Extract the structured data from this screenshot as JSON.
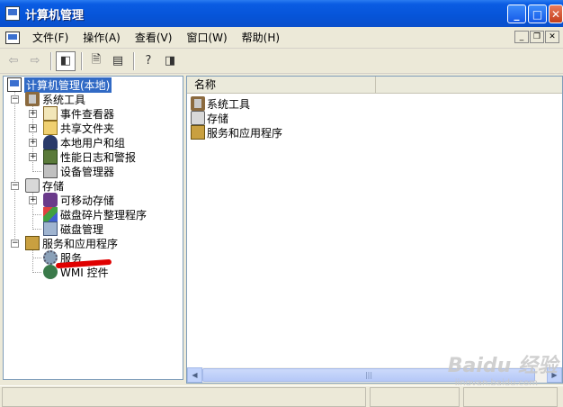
{
  "window": {
    "title": "计算机管理"
  },
  "menu": {
    "items": [
      "文件(F)",
      "操作(A)",
      "查看(V)",
      "窗口(W)",
      "帮助(H)"
    ]
  },
  "toolbar": {
    "buttons": [
      "back-icon",
      "forward-icon",
      "show-hide-tree-icon",
      "properties-icon",
      "export-list-icon",
      "help-icon",
      "show-hide-action-pane-icon"
    ]
  },
  "tree": {
    "root": "计算机管理(本地)",
    "system_tools": "系统工具",
    "event_viewer": "事件查看器",
    "shared_folders": "共享文件夹",
    "local_users": "本地用户和组",
    "perf_logs": "性能日志和警报",
    "device_manager": "设备管理器",
    "storage": "存储",
    "removable_storage": "可移动存储",
    "defrag": "磁盘碎片整理程序",
    "disk_management": "磁盘管理",
    "services_apps": "服务和应用程序",
    "services": "服务",
    "wmi": "WMI 控件"
  },
  "list": {
    "column_name": "名称",
    "items": [
      "系统工具",
      "存储",
      "服务和应用程序"
    ]
  },
  "watermark": {
    "text": "Baidu 经验",
    "sub": "jingyan.baidu.com"
  },
  "colors": {
    "title_bar": "#0654D8",
    "selection": "#316AC5",
    "annotation": "#E00000"
  }
}
